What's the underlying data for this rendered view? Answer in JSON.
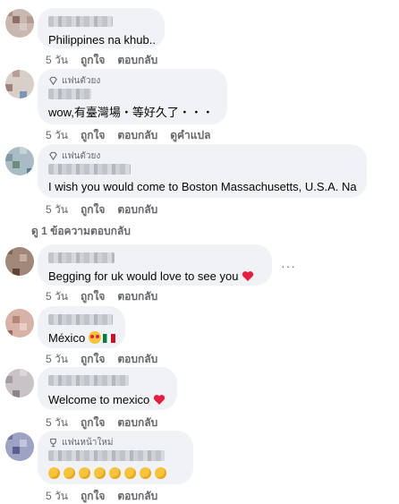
{
  "comments": [
    {
      "badge": "",
      "text": "Philippines na khub..",
      "actions": [
        "5 วัน",
        "ถูกใจ",
        "ตอบกลับ"
      ]
    },
    {
      "badge": "แฟนตัวยง",
      "text": "wow,有臺灣場・等好久了・・・",
      "actions": [
        "5 วัน",
        "ถูกใจ",
        "ตอบกลับ",
        "ดูคำแปล"
      ]
    },
    {
      "badge": "แฟนตัวยง",
      "text": "I wish you would come to Boston Massachusetts, U.S.A. Na",
      "actions": [
        "5 วัน",
        "ถูกใจ",
        "ตอบกลับ"
      ]
    },
    {
      "badge": "",
      "text": "Begging for uk would love to see you",
      "actions": [
        "5 วัน",
        "ถูกใจ",
        "ตอบกลับ"
      ]
    },
    {
      "badge": "",
      "text": "México",
      "actions": [
        "5 วัน",
        "ถูกใจ",
        "ตอบกลับ"
      ]
    },
    {
      "badge": "",
      "text": "Welcome to mexico",
      "actions": [
        "5 วัน",
        "ถูกใจ",
        "ตอบกลับ"
      ]
    },
    {
      "badge": "แฟนหน้าใหม่",
      "text": "",
      "actions": [
        "5 วัน",
        "ถูกใจ",
        "ตอบกลับ"
      ]
    }
  ],
  "view_replies": "ดู 1 ข้อความตอบกลับ",
  "more_options": "···",
  "colors": {
    "bubble": "#f0f2f5",
    "muted_text": "#65676b",
    "heart": "#e41e3f"
  },
  "icons": [
    "diamond-badge-icon",
    "trophy-badge-icon",
    "heart-emoji-icon",
    "star-eyes-emoji-icon",
    "mexico-flag-icon",
    "clapping-hands-icon"
  ]
}
